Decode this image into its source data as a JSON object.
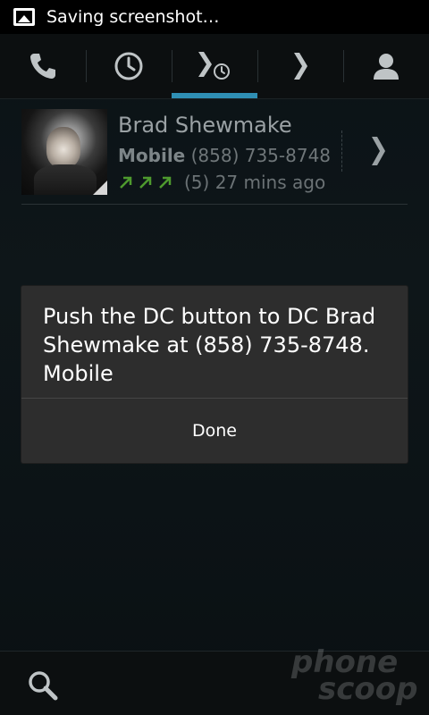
{
  "status_bar": {
    "notification_icon": "image-icon",
    "text": "Saving screenshot…"
  },
  "tabs": [
    {
      "name": "phone",
      "icon": "phone-icon",
      "active": false
    },
    {
      "name": "call-log",
      "icon": "clock-icon",
      "active": false
    },
    {
      "name": "recent-calls",
      "icon": "chevron-clock-icon",
      "active": true
    },
    {
      "name": "more",
      "icon": "chevron-right-icon",
      "active": false
    },
    {
      "name": "contacts",
      "icon": "person-icon",
      "active": false
    }
  ],
  "call_entry": {
    "name": "Brad Shewmake",
    "number_type": "Mobile",
    "number": "(858) 735-8748",
    "call_count": "(5)",
    "time_ago": "27 mins ago",
    "call_types": [
      "outgoing",
      "outgoing",
      "outgoing"
    ]
  },
  "dialog": {
    "message": "Push the DC button to DC Brad Shewmake at (858) 735-8748. Mobile",
    "button_label": "Done"
  },
  "bottom_bar": {
    "search_icon": "search-icon"
  },
  "watermark": {
    "line1": "phone",
    "line2": "scoop"
  },
  "colors": {
    "accent": "#2f8fb4",
    "outgoing_arrow": "#4e9a2e",
    "dialog_bg": "#2d2d2d"
  }
}
